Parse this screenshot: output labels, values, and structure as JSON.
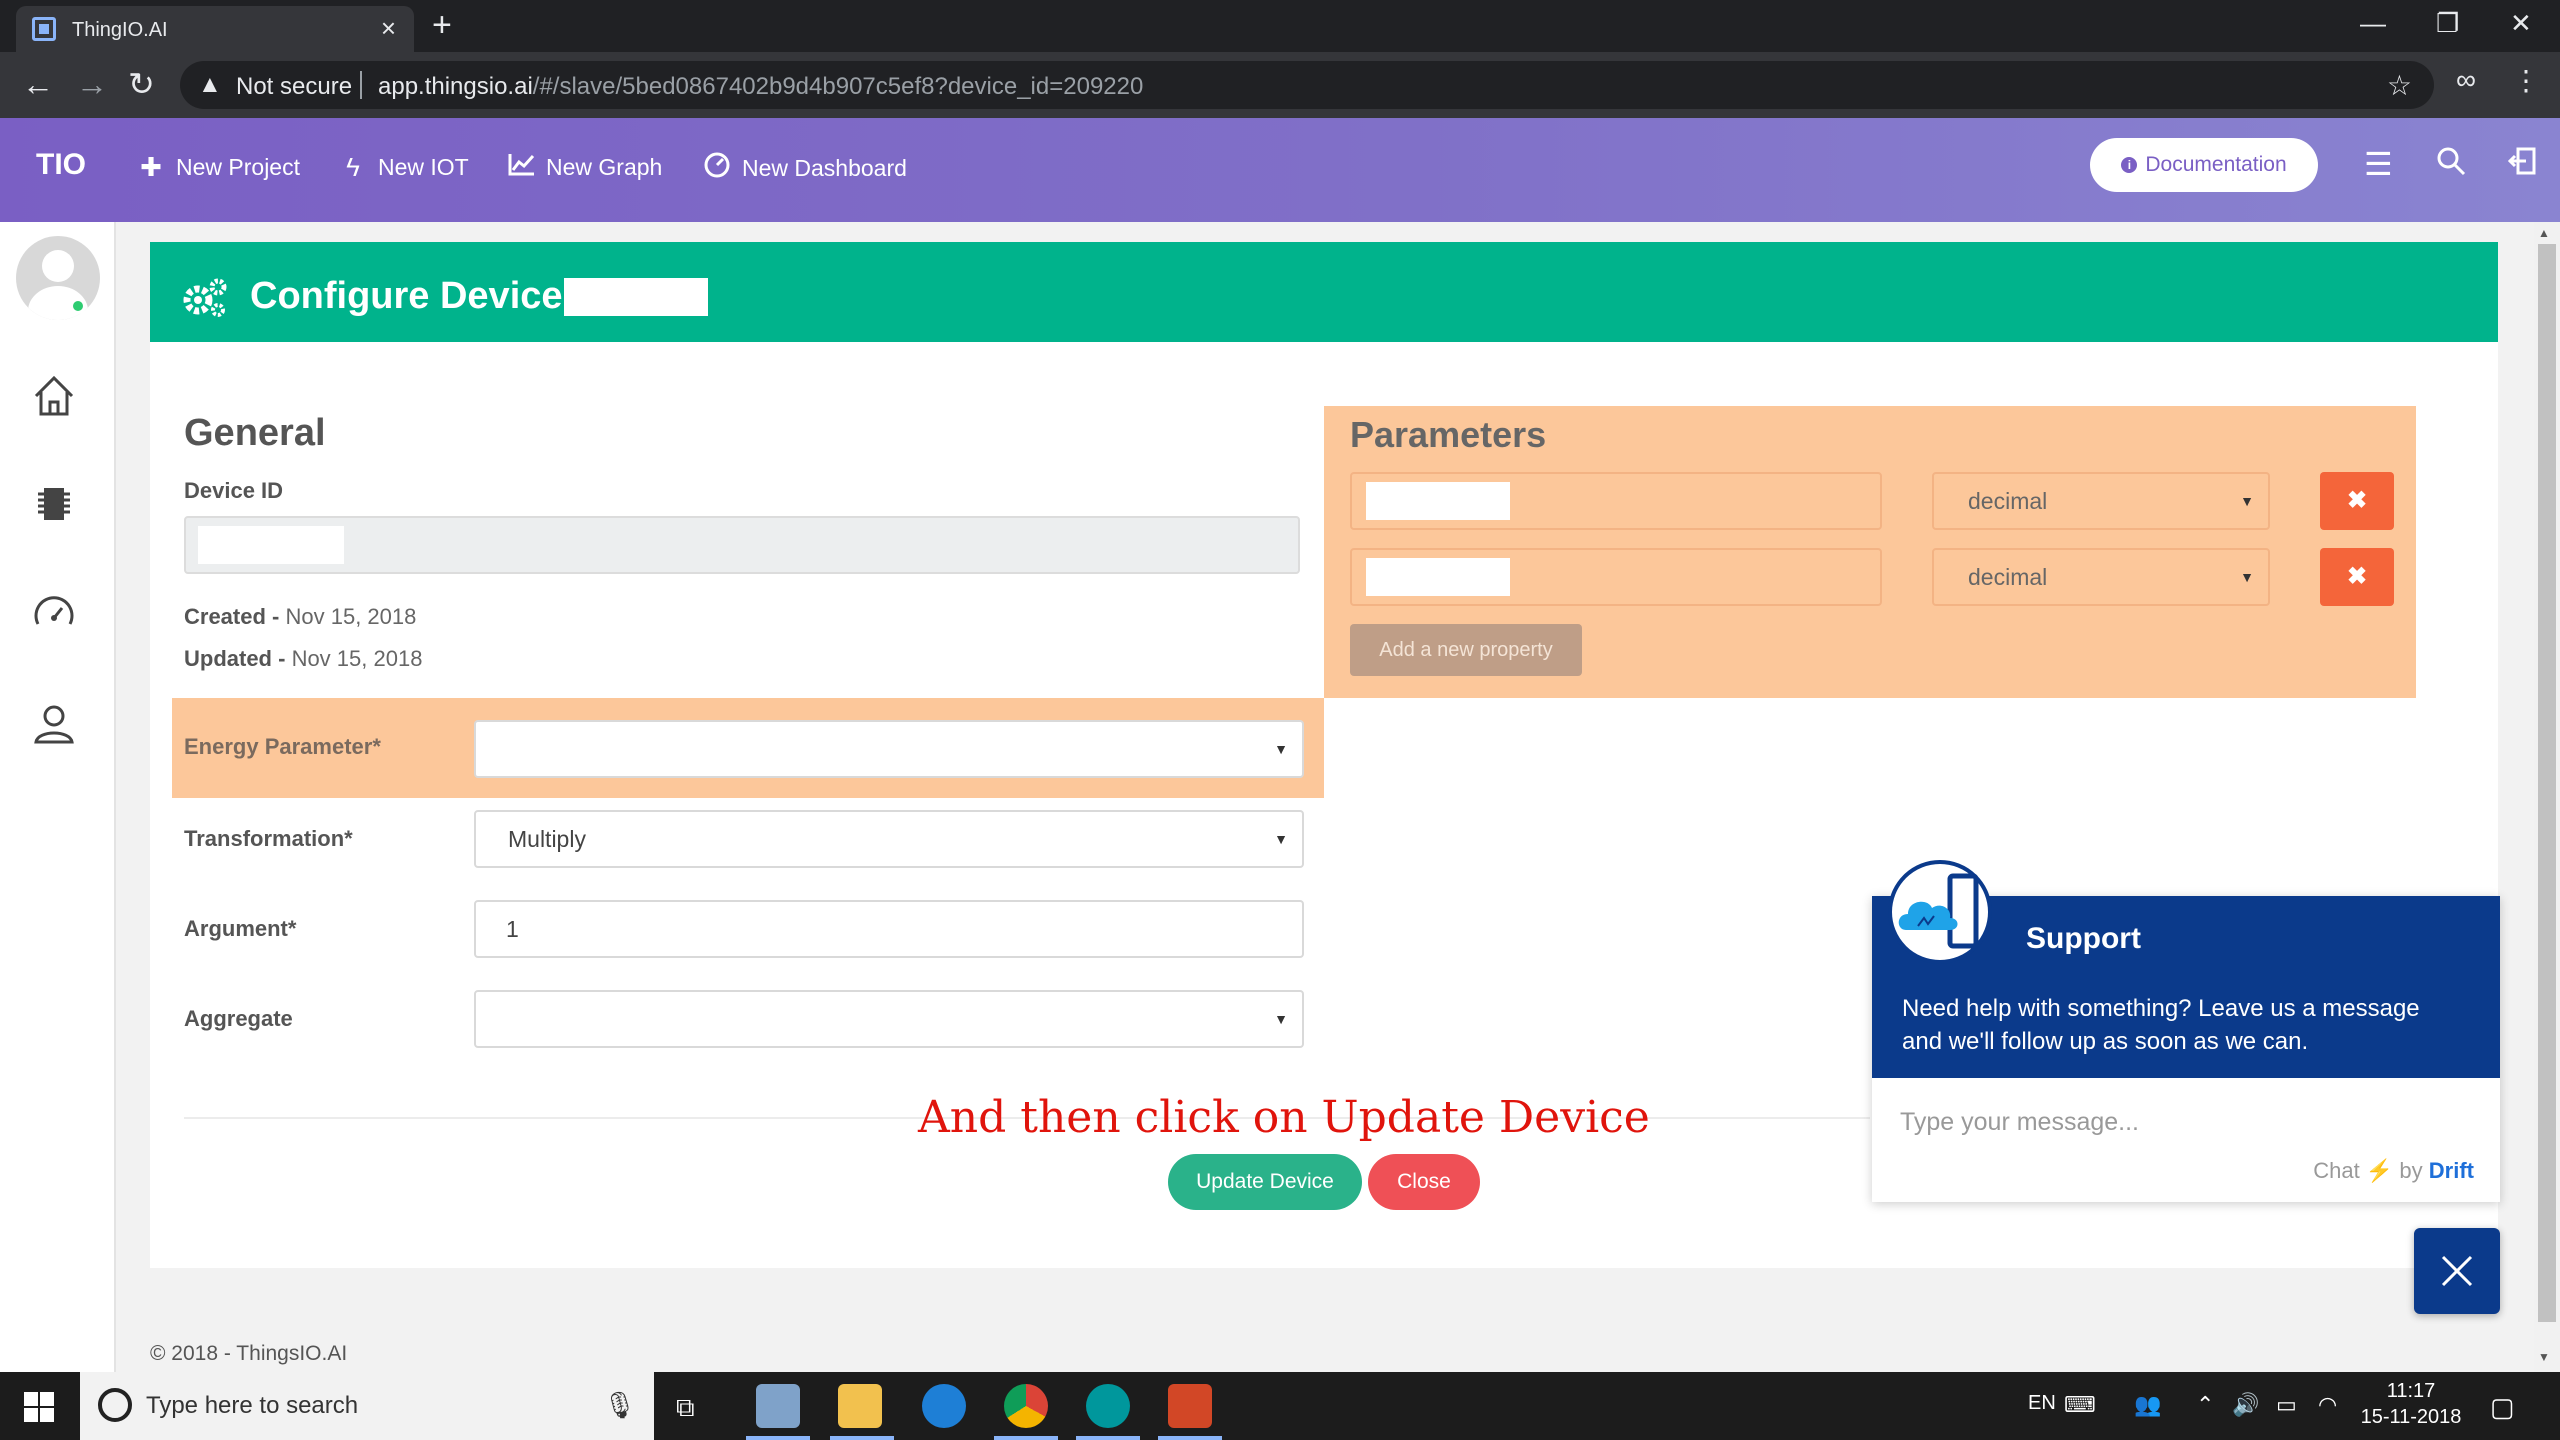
{
  "browser": {
    "tab_title": "ThingIO.AI",
    "not_secure": "Not secure",
    "url_host": "app.thingsio.ai",
    "url_path": "/#/slave/5bed0867402b9d4b907c5ef8?device_id=209220"
  },
  "header": {
    "brand": "TIO",
    "nav": [
      {
        "label": "New Project",
        "icon": "plus-icon"
      },
      {
        "label": "New IOT",
        "icon": "bolt-icon"
      },
      {
        "label": "New Graph",
        "icon": "line-chart-icon"
      },
      {
        "label": "New Dashboard",
        "icon": "gauge-icon"
      }
    ],
    "documentation": "Documentation"
  },
  "page": {
    "title": "Configure Device -",
    "general_heading": "General",
    "device_id_label": "Device ID",
    "created_label": "Created - ",
    "created_value": "Nov 15, 2018",
    "updated_label": "Updated - ",
    "updated_value": "Nov 15, 2018",
    "energy_label": "Energy Parameter*",
    "transformation_label": "Transformation*",
    "transformation_value": "Multiply",
    "argument_label": "Argument*",
    "argument_value": "1",
    "aggregate_label": "Aggregate",
    "aggregate_value": ""
  },
  "parameters": {
    "heading": "Parameters",
    "rows": [
      {
        "type": "decimal"
      },
      {
        "type": "decimal"
      }
    ],
    "add_label": "Add a new property"
  },
  "annotation": "And then click on Update Device",
  "actions": {
    "update": "Update Device",
    "close": "Close"
  },
  "footer": "© 2018 - ThingsIO.AI",
  "chat": {
    "title": "Support",
    "message": "Need help with something? Leave us a message and we'll follow up as soon as we can.",
    "placeholder": "Type your message...",
    "powered_prefix": "Chat",
    "powered_by": "by",
    "powered_brand": "Drift"
  },
  "taskbar": {
    "search_placeholder": "Type here to search",
    "lang": "EN",
    "time": "11:17",
    "date": "15-11-2018"
  },
  "colors": {
    "header_purple": "#7a5fc4",
    "banner_green": "#00b38c",
    "highlight_orange": "#fcc79a",
    "delete_red": "#f4653a",
    "chat_navy": "#0b3a8b",
    "annotation_red": "#e0140c"
  }
}
